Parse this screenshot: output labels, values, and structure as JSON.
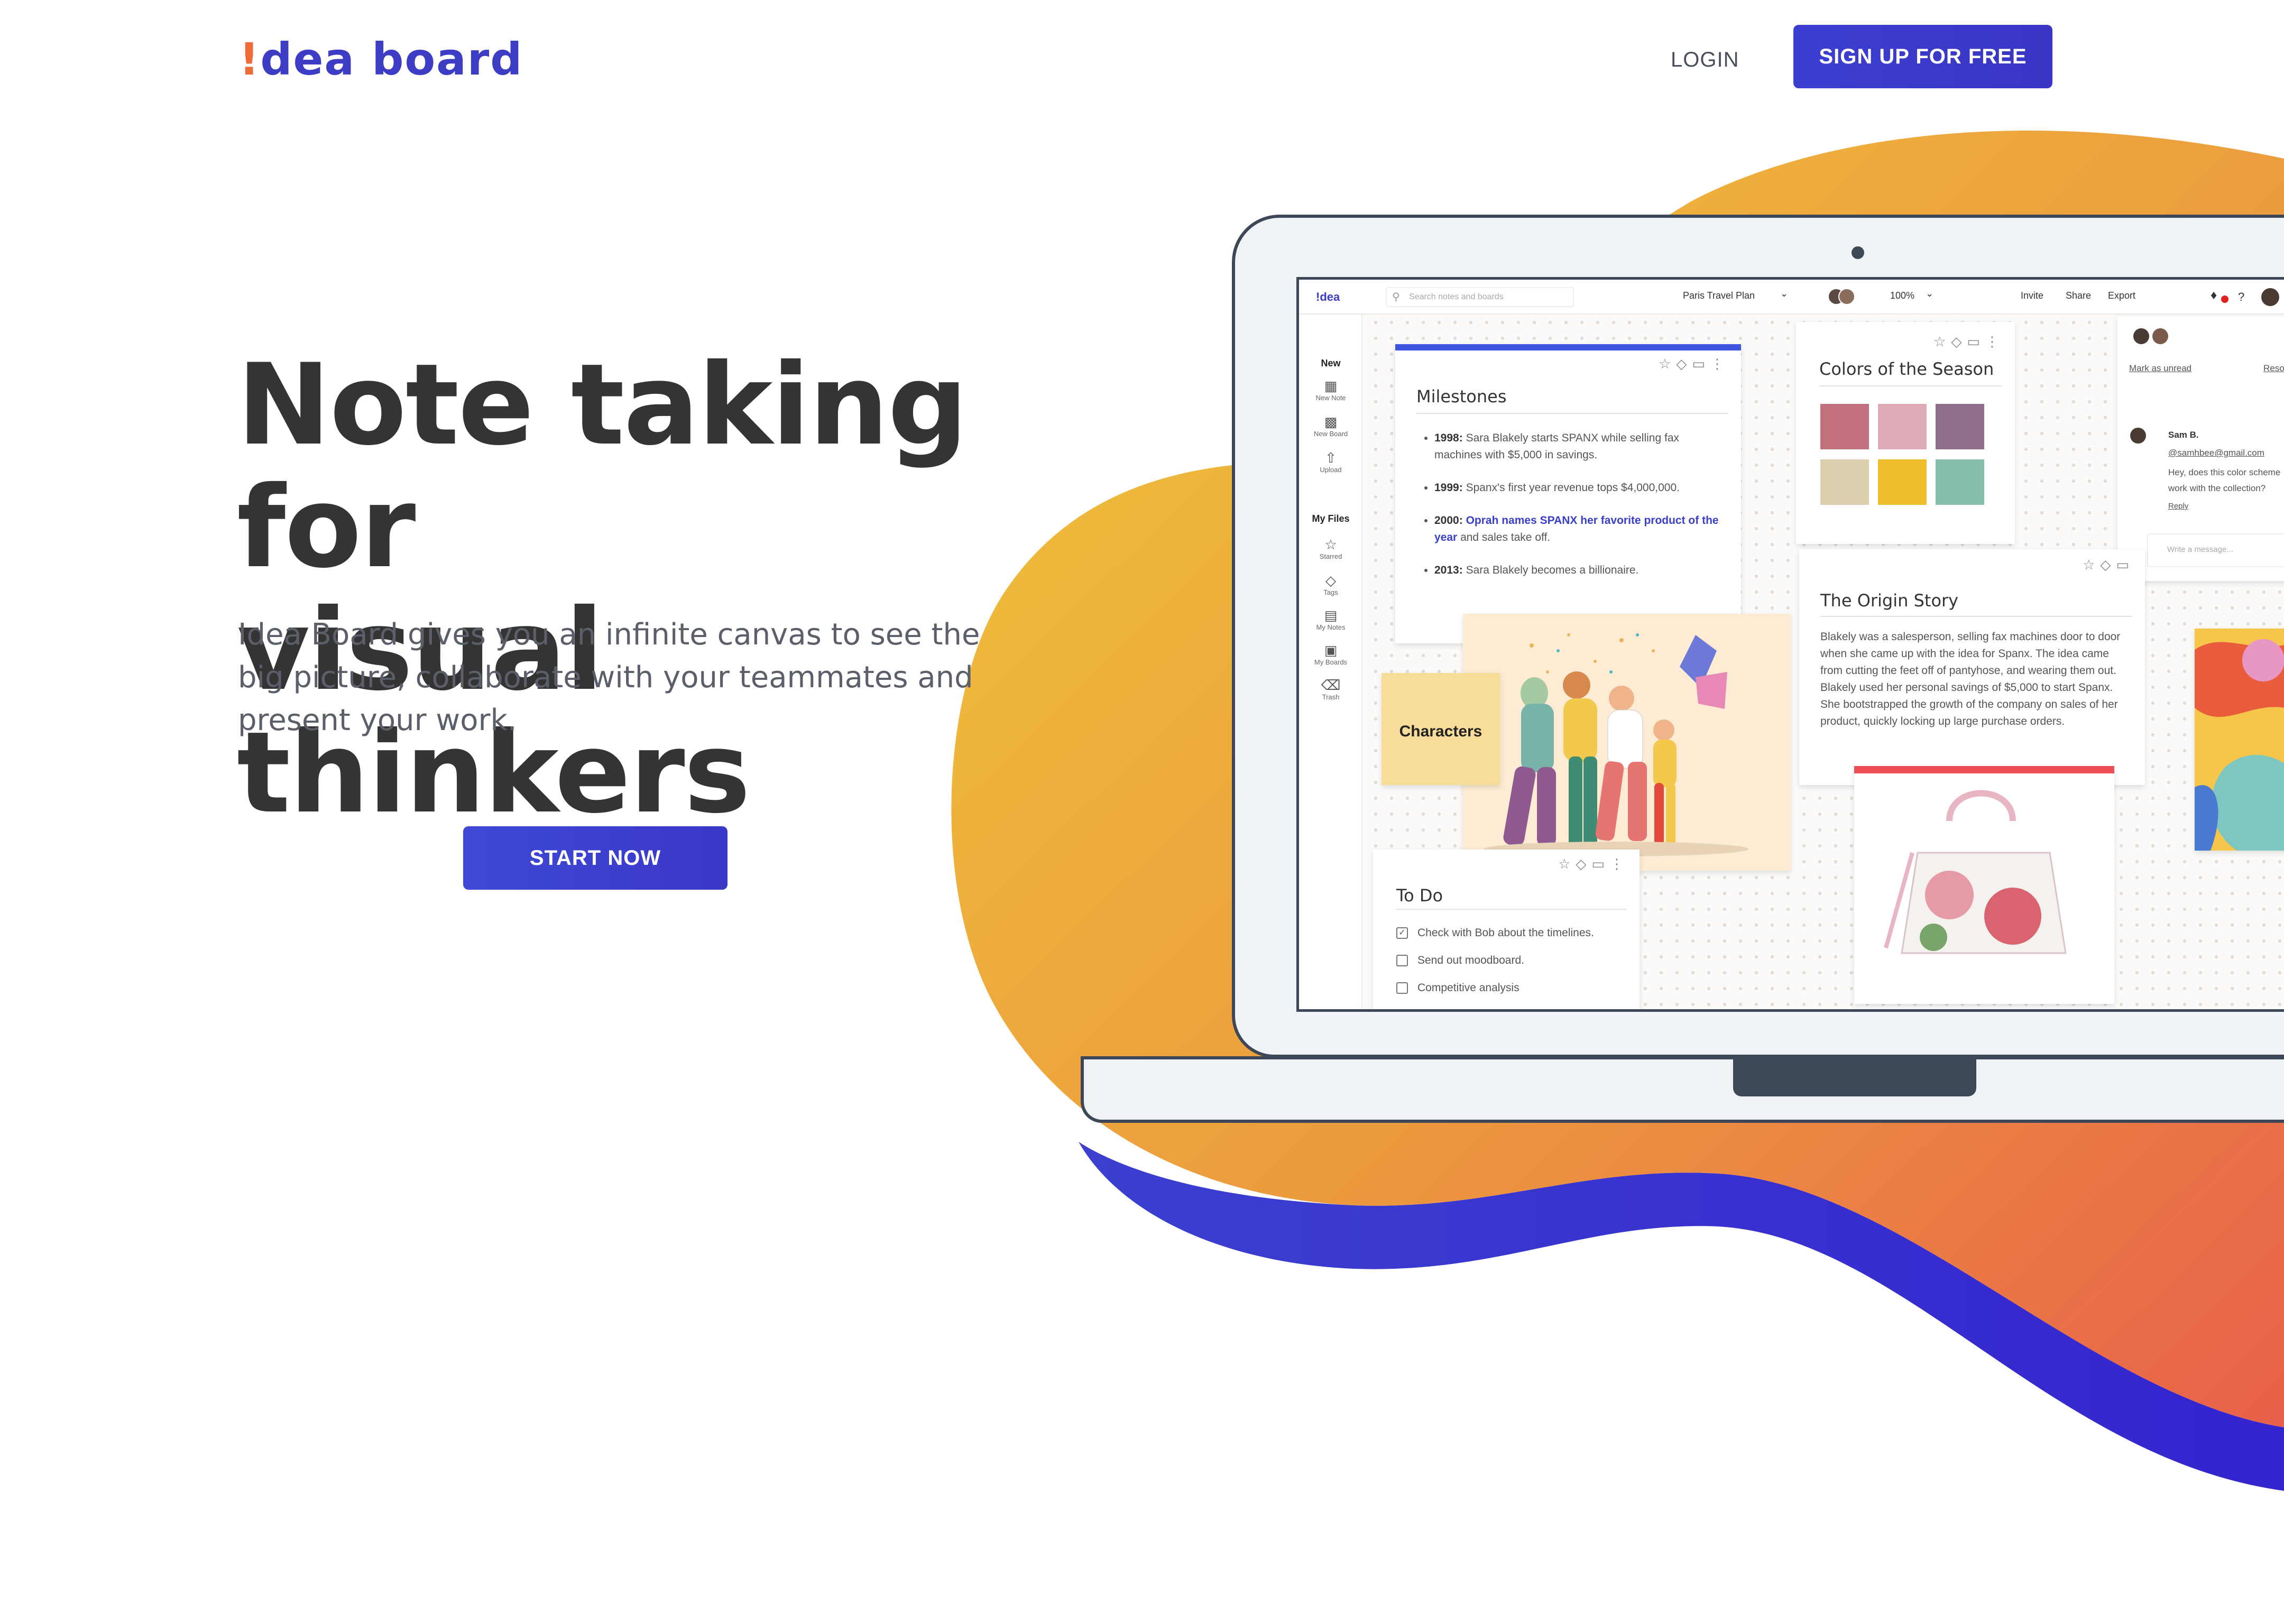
{
  "header": {
    "logo_mark": "!",
    "logo_text": "dea board",
    "login_label": "LOGIN",
    "signup_label": "SIGN UP FOR FREE"
  },
  "hero": {
    "headline_line1": "Note taking for",
    "headline_line2": "visual thinkers",
    "subtext": "Idea Board gives you an infinite canvas to see the big picture, collaborate with your teammates and present your work.",
    "cta_label": "START NOW"
  },
  "app": {
    "logo": "!dea",
    "search_placeholder": "Search notes and boards",
    "board_name": "Paris Travel Plan",
    "zoom": "100%",
    "invite_label": "Invite",
    "share_label": "Share",
    "export_label": "Export",
    "help_label": "?",
    "sidebar": {
      "new_heading": "New",
      "new_note": "New Note",
      "new_board": "New Board",
      "upload": "Upload",
      "files_heading": "My Files",
      "starred": "Starred",
      "tags": "Tags",
      "my_notes": "My Notes",
      "my_boards": "My Boards",
      "trash": "Trash"
    },
    "milestones": {
      "title": "Milestones",
      "items": [
        {
          "year": "1998:",
          "text": "Sara Blakely starts SPANX while selling fax machines with $5,000 in savings."
        },
        {
          "year": "1999:",
          "text": "Spanx's first year revenue tops $4,000,000."
        },
        {
          "year": "2000:",
          "highlight": "Oprah names SPANX her favorite product of the year",
          "text": "and sales take off."
        },
        {
          "year": "2013:",
          "text": "Sara Blakely becomes a billionaire."
        }
      ]
    },
    "colors_card": {
      "title": "Colors of the Season",
      "swatches": [
        "#c2707e",
        "#ddaab5",
        "#8f6e8c",
        "#dccfad",
        "#edbd2c",
        "#87bdab"
      ]
    },
    "origin": {
      "title": "The Origin Story",
      "body": "Blakely was a salesperson, selling fax machines door to door when she came up with the idea for Spanx. The idea came from cutting the feet off of pantyhose, and wearing them out. Blakely used her personal savings of $5,000 to start Spanx. She bootstrapped the growth of the company on sales of her product, quickly locking up large purchase orders."
    },
    "characters_label": "Characters",
    "todo": {
      "title": "To Do",
      "items": [
        {
          "text": "Check with Bob about the timelines.",
          "checked": true
        },
        {
          "text": "Send out moodboard.",
          "checked": false
        },
        {
          "text": "Competitive analysis",
          "checked": false
        }
      ]
    },
    "chat": {
      "mark_unread": "Mark as unread",
      "resolve": "Reso",
      "author": "Sam B.",
      "mention": "@samhbee@gmail.com",
      "message": "Hey, does this color scheme work with the collection?",
      "reply": "Reply",
      "input_placeholder": "Write a message..."
    }
  },
  "colors": {
    "brand_blue": "#3b3fd0",
    "accent_orange": "#f06b3a",
    "blob_yellow": "#efc23a",
    "blob_orange": "#e96b43",
    "blob_blue": "#3538c8"
  }
}
